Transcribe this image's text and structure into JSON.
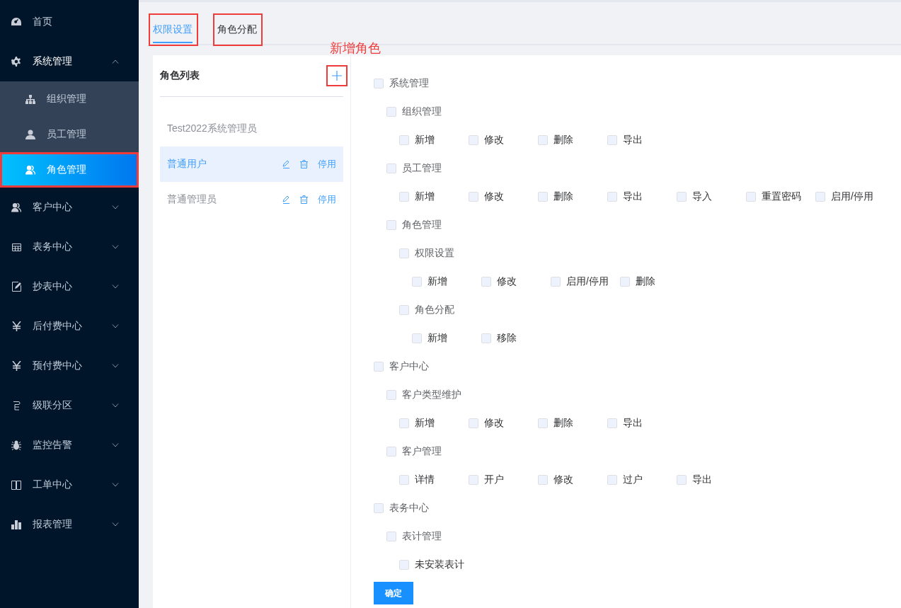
{
  "sidebar": {
    "items": [
      {
        "label": "首页",
        "highlighted": false
      },
      {
        "label": "系统管理",
        "expanded": true,
        "highlighted": false,
        "children": [
          {
            "label": "组织管理",
            "selected": false,
            "highlighted": false
          },
          {
            "label": "员工管理",
            "selected": false,
            "highlighted": false
          },
          {
            "label": "角色管理",
            "selected": true,
            "highlighted": true
          }
        ]
      },
      {
        "label": "客户中心",
        "expanded": false,
        "highlighted": false
      },
      {
        "label": "表务中心",
        "expanded": false,
        "highlighted": false
      },
      {
        "label": "抄表中心",
        "expanded": false,
        "highlighted": false
      },
      {
        "label": "后付费中心",
        "expanded": false,
        "highlighted": false
      },
      {
        "label": "预付费中心",
        "expanded": false,
        "highlighted": false
      },
      {
        "label": "级联分区",
        "expanded": false,
        "highlighted": false
      },
      {
        "label": "监控告警",
        "expanded": false,
        "highlighted": false
      },
      {
        "label": "工单中心",
        "expanded": false,
        "highlighted": false
      },
      {
        "label": "报表管理",
        "expanded": false,
        "highlighted": false
      }
    ]
  },
  "tabs": [
    {
      "label": "权限设置",
      "selected": true,
      "highlighted": true
    },
    {
      "label": "角色分配",
      "selected": false,
      "highlighted": true
    }
  ],
  "annotation": "新增角色",
  "role_list": {
    "title": "角色列表",
    "add_highlighted": true,
    "roles": [
      {
        "name": "Test2022系统管理员",
        "selected": false
      },
      {
        "name": "普通用户",
        "selected": true,
        "toggle_label": "停用"
      },
      {
        "name": "普通管理员",
        "selected": false,
        "toggle_label": "停用"
      }
    ]
  },
  "permissions": [
    {
      "label": "系统管理",
      "checked": false,
      "children": [
        {
          "label": "组织管理",
          "checked": false,
          "children": [
            {
              "label": "新增",
              "checked": false
            },
            {
              "label": "修改",
              "checked": false
            },
            {
              "label": "删除",
              "checked": false
            },
            {
              "label": "导出",
              "checked": false
            }
          ]
        },
        {
          "label": "员工管理",
          "checked": false,
          "children": [
            {
              "label": "新增",
              "checked": false
            },
            {
              "label": "修改",
              "checked": false
            },
            {
              "label": "删除",
              "checked": false
            },
            {
              "label": "导出",
              "checked": false
            },
            {
              "label": "导入",
              "checked": false
            },
            {
              "label": "重置密码",
              "checked": false
            },
            {
              "label": "启用/停用",
              "checked": false
            }
          ]
        },
        {
          "label": "角色管理",
          "checked": false,
          "children": [
            {
              "label": "权限设置",
              "checked": false,
              "children": [
                {
                  "label": "新增",
                  "checked": false
                },
                {
                  "label": "修改",
                  "checked": false
                },
                {
                  "label": "启用/停用",
                  "checked": false
                },
                {
                  "label": "删除",
                  "checked": false
                }
              ]
            },
            {
              "label": "角色分配",
              "checked": false,
              "children": [
                {
                  "label": "新增",
                  "checked": false
                },
                {
                  "label": "移除",
                  "checked": false
                }
              ]
            }
          ]
        }
      ]
    },
    {
      "label": "客户中心",
      "checked": false,
      "children": [
        {
          "label": "客户类型维护",
          "checked": false,
          "children": [
            {
              "label": "新增",
              "checked": false
            },
            {
              "label": "修改",
              "checked": false
            },
            {
              "label": "删除",
              "checked": false
            },
            {
              "label": "导出",
              "checked": false
            }
          ]
        },
        {
          "label": "客户管理",
          "checked": false,
          "children": [
            {
              "label": "详情",
              "checked": false
            },
            {
              "label": "开户",
              "checked": false
            },
            {
              "label": "修改",
              "checked": false
            },
            {
              "label": "过户",
              "checked": false
            },
            {
              "label": "导出",
              "checked": false
            }
          ]
        }
      ]
    },
    {
      "label": "表务中心",
      "checked": false,
      "children": [
        {
          "label": "表计管理",
          "checked": false,
          "children": [
            {
              "label": "未安装表计",
              "checked": false
            }
          ]
        }
      ]
    }
  ],
  "confirm_button": "确定"
}
